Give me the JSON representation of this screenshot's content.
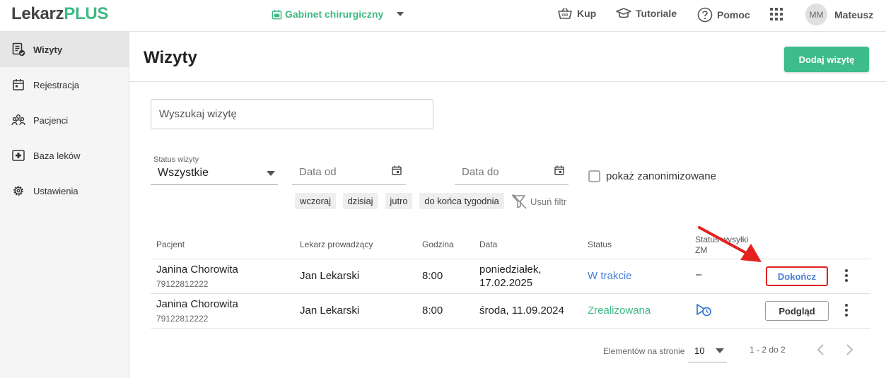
{
  "header": {
    "logo_part1": "Lekarz",
    "logo_part2": "PLUS",
    "clinic": "Gabinet chirurgiczny",
    "nav": [
      {
        "label": "Kup",
        "icon": "basket-icon"
      },
      {
        "label": "Tutoriale",
        "icon": "graduation-cap-icon"
      },
      {
        "label": "Pomoc",
        "icon": "help-circle-icon"
      }
    ],
    "apps_icon": "apps-grid-icon",
    "user_initials": "MM",
    "user_name": "Mateusz"
  },
  "sidebar": {
    "items": [
      {
        "label": "Wizyty",
        "icon": "visits-clipboard-icon",
        "active": true
      },
      {
        "label": "Rejestracja",
        "icon": "calendar-icon",
        "active": false
      },
      {
        "label": "Pacjenci",
        "icon": "patients-icon",
        "active": false
      },
      {
        "label": "Baza leków",
        "icon": "medkit-icon",
        "active": false
      },
      {
        "label": "Ustawienia",
        "icon": "gear-icon",
        "active": false
      }
    ]
  },
  "main": {
    "title": "Wizyty",
    "add_button": "Dodaj wizytę",
    "search_placeholder": "Wyszukaj wizytę",
    "filters": {
      "status_label": "Status wizyty",
      "status_value": "Wszystkie",
      "date_from_placeholder": "Data od",
      "date_to_placeholder": "Data do",
      "show_anonymized": "pokaż zanonimizowane",
      "chips": [
        "wczoraj",
        "dzisiaj",
        "jutro",
        "do końca tygodnia"
      ],
      "clear_filter": "Usuń filtr"
    },
    "table": {
      "headers": {
        "patient": "Pacjent",
        "doctor": "Lekarz prowadzący",
        "time": "Godzina",
        "date": "Data",
        "status": "Status",
        "zm_line1": "Status wysyłki",
        "zm_line2": "ZM"
      },
      "rows": [
        {
          "patient": "Janina Chorowita",
          "pesel": "79122812222",
          "doctor": "Jan Lekarski",
          "time": "8:00",
          "date_line1": "poniedziałek,",
          "date_line2": "17.02.2025",
          "status": "W trakcie",
          "zm_status": "–",
          "action": "Dokończ"
        },
        {
          "patient": "Janina Chorowita",
          "pesel": "79122812222",
          "doctor": "Jan Lekarski",
          "time": "8:00",
          "date_line1": "środa, 11.09.2024",
          "status": "Zrealizowana",
          "zm_icon": "pending-send-icon",
          "action": "Podgląd"
        }
      ]
    },
    "pagination": {
      "per_page_label": "Elementów na stronie",
      "per_page_value": "10",
      "range": "1 - 2 do 2"
    }
  },
  "colors": {
    "brand_green": "#3db984",
    "progress_blue": "#4a7fd6",
    "highlight_red": "#e02020"
  }
}
